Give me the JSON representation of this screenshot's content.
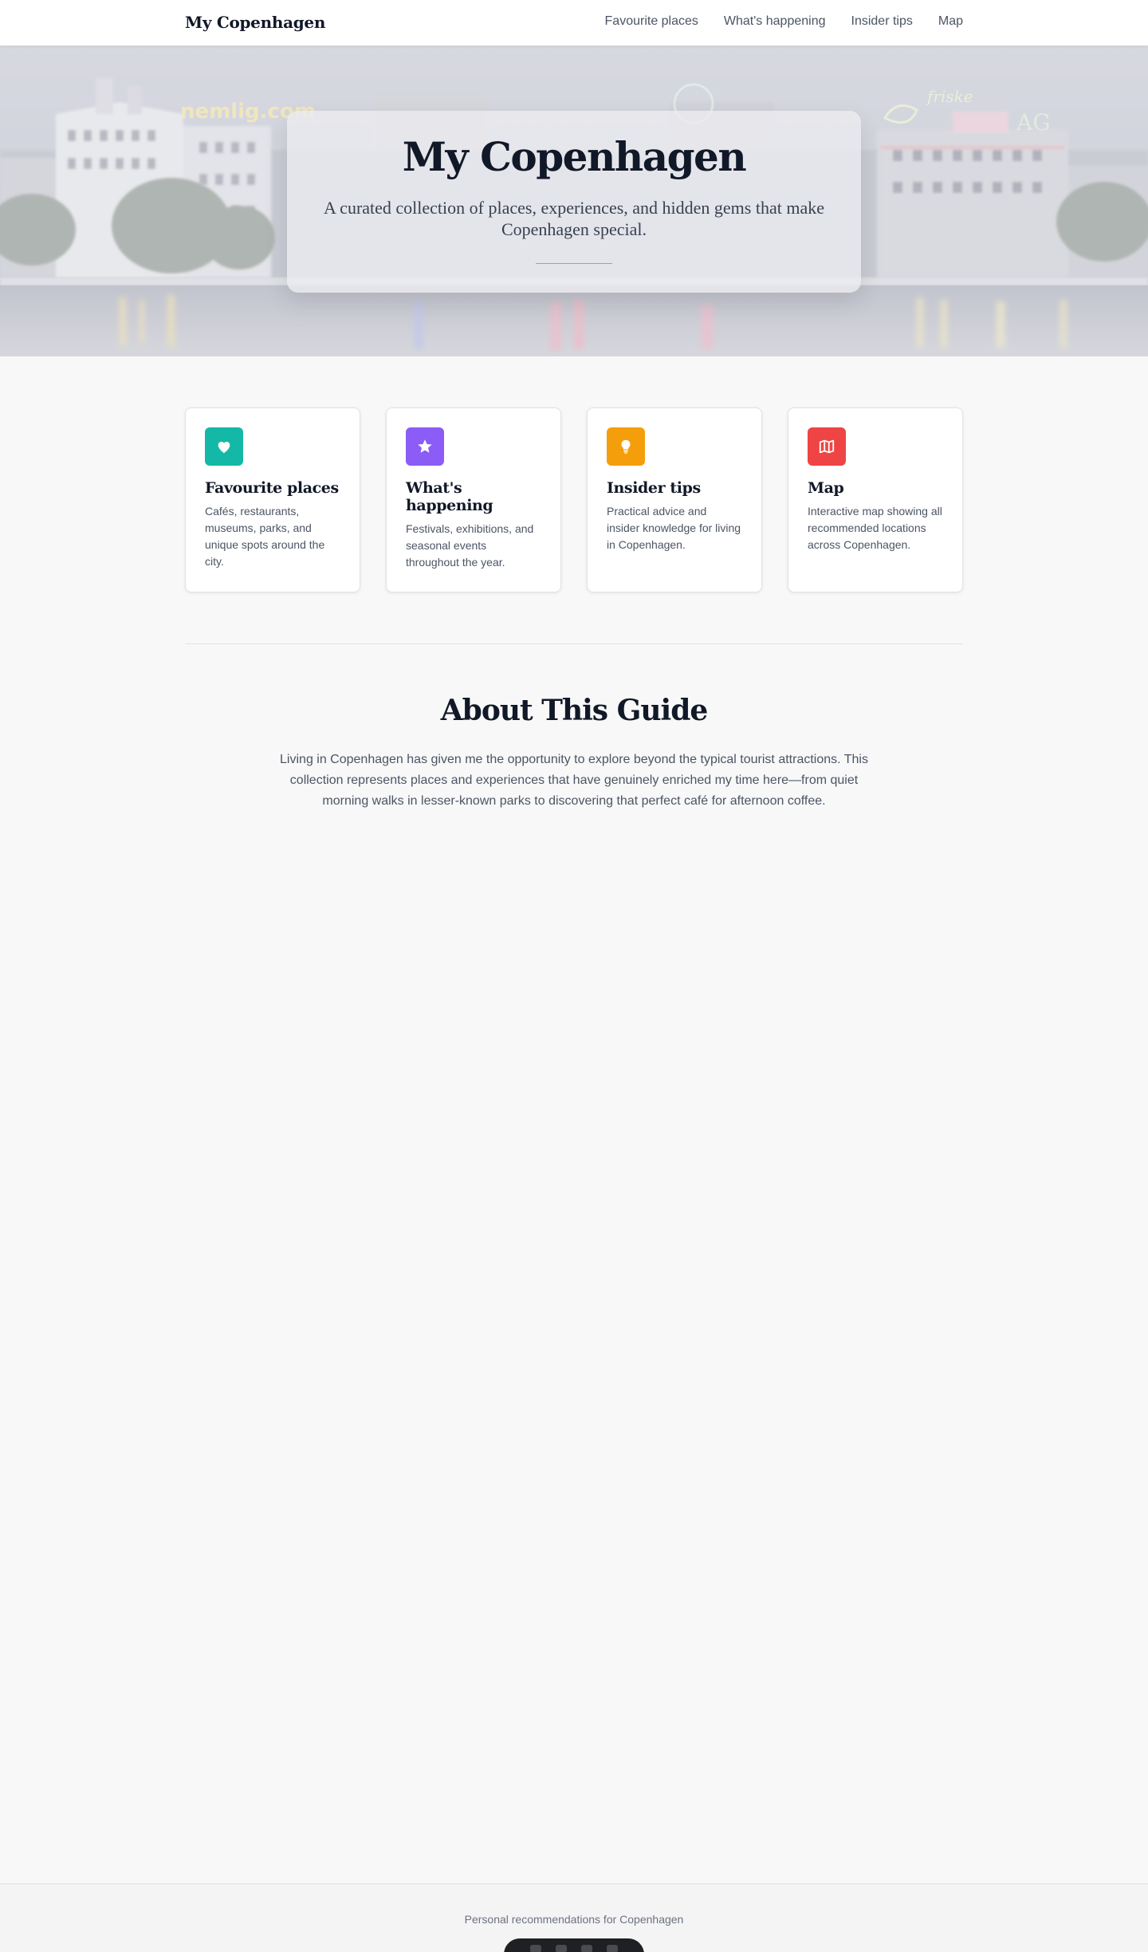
{
  "nav": {
    "brand": "My Copenhagen",
    "links": [
      "Favourite places",
      "What's happening",
      "Insider tips",
      "Map"
    ]
  },
  "hero": {
    "title": "My Copenhagen",
    "subtitle": "A curated collection of places, experiences, and hidden gems that make Copenhagen special.",
    "signs": {
      "left": "nemlig.com",
      "right": "friske",
      "right2": "AG"
    }
  },
  "cards": [
    {
      "title": "Favourite places",
      "description": "Cafés, restaurants, museums, parks, and unique spots around the city.",
      "icon": "heart-icon",
      "color": "#14b8a6"
    },
    {
      "title": "What's happening",
      "description": "Festivals, exhibitions, and seasonal events throughout the year.",
      "icon": "star-icon",
      "color": "#8b5cf6"
    },
    {
      "title": "Insider tips",
      "description": "Practical advice and insider knowledge for living in Copenhagen.",
      "icon": "lightbulb-icon",
      "color": "#f59e0b"
    },
    {
      "title": "Map",
      "description": "Interactive map showing all recommended locations across Copenhagen.",
      "icon": "map-icon",
      "color": "#ef4444"
    }
  ],
  "about": {
    "title": "About This Guide",
    "text": "Living in Copenhagen has given me the opportunity to explore beyond the typical tourist attractions. This collection represents places and experiences that have genuinely enriched my time here—from quiet morning walks in lesser-known parks to discovering that perfect café for afternoon coffee."
  },
  "footer": {
    "text": "Personal recommendations for Copenhagen"
  }
}
